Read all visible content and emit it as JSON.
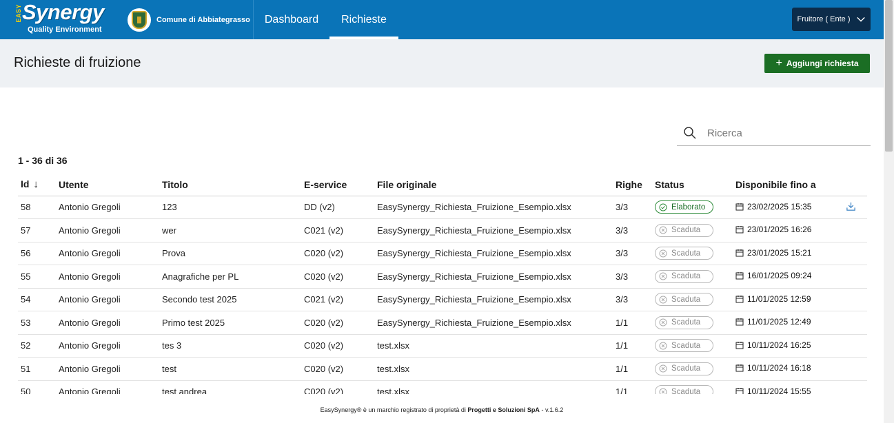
{
  "header": {
    "logo_easy": "EASY",
    "logo_synergy": "Synergy",
    "logo_tagline": "Quality Environment",
    "comune": "Comune di Abbiategrasso",
    "nav": [
      {
        "label": "Dashboard"
      },
      {
        "label": "Richieste"
      }
    ],
    "user_button": "Fruitore ( Ente )"
  },
  "page": {
    "title": "Richieste di fruizione",
    "add_button": "Aggiungi richiesta"
  },
  "search": {
    "placeholder": "Ricerca"
  },
  "count": "1 - 36 di 36",
  "table": {
    "headers": {
      "id": "Id",
      "utente": "Utente",
      "titolo": "Titolo",
      "eservice": "E-service",
      "file": "File originale",
      "righe": "Righe",
      "status": "Status",
      "disponibile": "Disponibile fino a"
    },
    "sort_arrow": "↓",
    "rows": [
      {
        "id": "58",
        "utente": "Antonio Gregoli",
        "titolo": "123",
        "eservice": "DD (v2)",
        "file": "EasySynergy_Richiesta_Fruizione_Esempio.xlsx",
        "righe": "3/3",
        "status": "Elaborato",
        "date": "23/02/2025 15:35",
        "state": "ok"
      },
      {
        "id": "57",
        "utente": "Antonio Gregoli",
        "titolo": "wer",
        "eservice": "C021 (v2)",
        "file": "EasySynergy_Richiesta_Fruizione_Esempio.xlsx",
        "righe": "3/3",
        "status": "Scaduta",
        "date": "23/01/2025 16:26",
        "state": "exp"
      },
      {
        "id": "56",
        "utente": "Antonio Gregoli",
        "titolo": "Prova",
        "eservice": "C020 (v2)",
        "file": "EasySynergy_Richiesta_Fruizione_Esempio.xlsx",
        "righe": "3/3",
        "status": "Scaduta",
        "date": "23/01/2025 15:21",
        "state": "exp"
      },
      {
        "id": "55",
        "utente": "Antonio Gregoli",
        "titolo": "Anagrafiche per PL",
        "eservice": "C020 (v2)",
        "file": "EasySynergy_Richiesta_Fruizione_Esempio.xlsx",
        "righe": "3/3",
        "status": "Scaduta",
        "date": "16/01/2025 09:24",
        "state": "exp"
      },
      {
        "id": "54",
        "utente": "Antonio Gregoli",
        "titolo": "Secondo test 2025",
        "eservice": "C021 (v2)",
        "file": "EasySynergy_Richiesta_Fruizione_Esempio.xlsx",
        "righe": "3/3",
        "status": "Scaduta",
        "date": "11/01/2025 12:59",
        "state": "exp"
      },
      {
        "id": "53",
        "utente": "Antonio Gregoli",
        "titolo": "Primo test 2025",
        "eservice": "C020 (v2)",
        "file": "EasySynergy_Richiesta_Fruizione_Esempio.xlsx",
        "righe": "1/1",
        "status": "Scaduta",
        "date": "11/01/2025 12:49",
        "state": "exp"
      },
      {
        "id": "52",
        "utente": "Antonio Gregoli",
        "titolo": "tes 3",
        "eservice": "C020 (v2)",
        "file": "test.xlsx",
        "righe": "1/1",
        "status": "Scaduta",
        "date": "10/11/2024 16:25",
        "state": "exp"
      },
      {
        "id": "51",
        "utente": "Antonio Gregoli",
        "titolo": "test",
        "eservice": "C020 (v2)",
        "file": "test.xlsx",
        "righe": "1/1",
        "status": "Scaduta",
        "date": "10/11/2024 16:18",
        "state": "exp"
      },
      {
        "id": "50",
        "utente": "Antonio Gregoli",
        "titolo": "test andrea",
        "eservice": "C020 (v2)",
        "file": "test.xlsx",
        "righe": "1/1",
        "status": "Scaduta",
        "date": "10/11/2024 15:55",
        "state": "exp"
      }
    ]
  },
  "footer": {
    "prefix": "EasySynergy® è un marchio registrato di proprietà di",
    "company": "Progetti e Soluzioni SpA",
    "suffix": "- v.1.6.2"
  },
  "colors": {
    "header_bg": "#0a74b8",
    "user_button_bg": "#0c2c4a",
    "add_button_bg": "#1b6e24",
    "status_ok": "#2e8b3a",
    "status_expired": "#8a8a8a"
  },
  "icons": [
    "chevron-down-icon",
    "plus-icon",
    "search-icon",
    "sort-down-icon",
    "check-circle-icon",
    "x-circle-icon",
    "calendar-icon",
    "download-icon"
  ]
}
